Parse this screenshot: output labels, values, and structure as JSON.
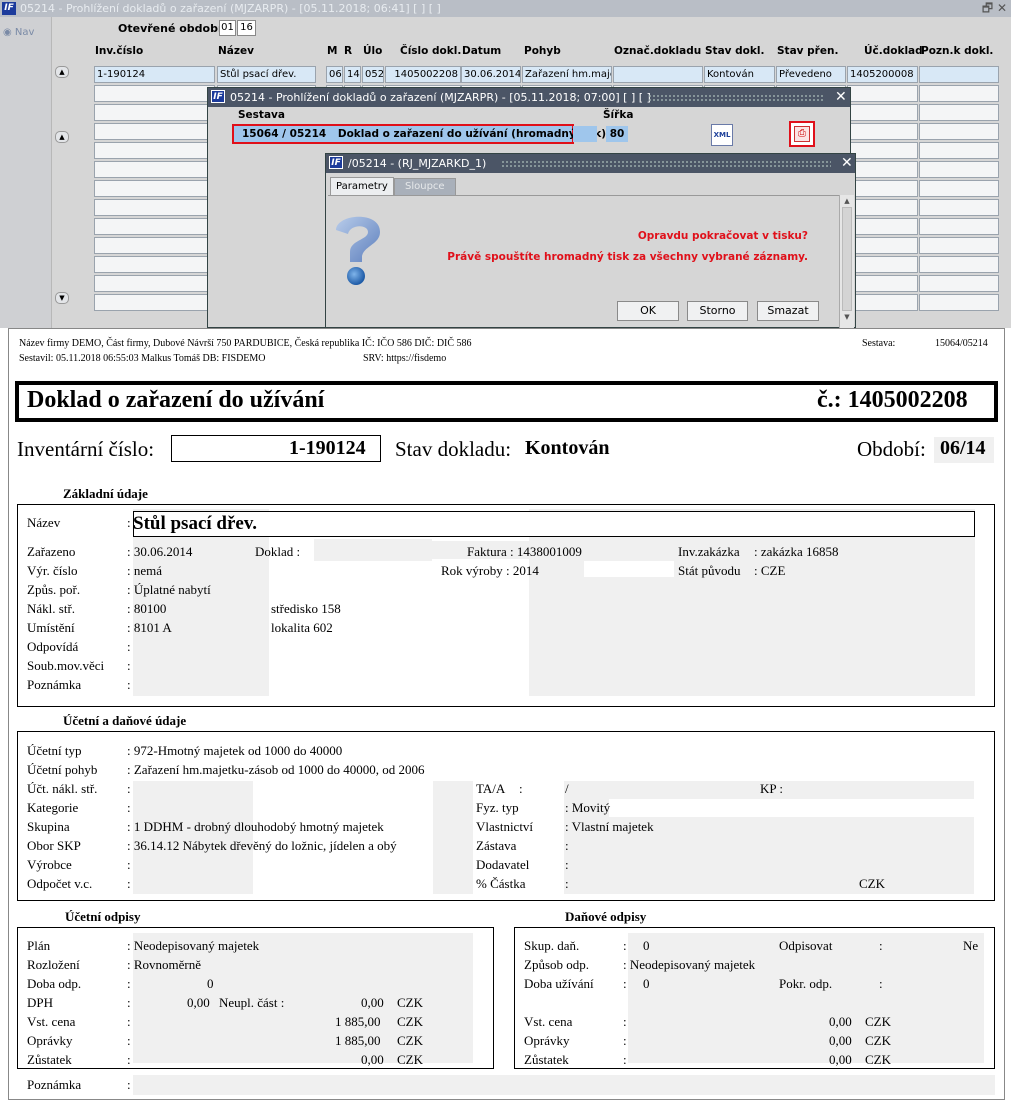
{
  "app": {
    "title": "05214 - Prohlížení dokladů o zařazení (MJZARPR) - [05.11.2018; 06:41] [ ] [ ]",
    "logo": "IF",
    "controls": "🗗 ✕",
    "nav_label": "◉ Nav",
    "period_label": "Otevřené období",
    "period_month": "01",
    "period_year": "16",
    "columns": [
      "Inv.číslo",
      "Název",
      "M",
      "R",
      "Úlo",
      "Číslo dokl.",
      "Datum",
      "Pohyb",
      "Označ.dokladu",
      "Stav dokl.",
      "Stav přen.",
      "Úč.doklad",
      "Pozn.k dokl."
    ],
    "row": {
      "inv": "1-190124",
      "nazev": "Stůl psací dřev.",
      "m": "06",
      "r": "14",
      "ulo": "052",
      "cislo": "1405002208",
      "datum": "30.06.2014",
      "pohyb": "Zařazení hm.maje",
      "oznac": "",
      "stav": "Kontován",
      "stav_pren": "Převedeno",
      "uc_doklad": "1405200008"
    }
  },
  "dialog1": {
    "title": "05214 - Prohlížení dokladů o zařazení (MJZARPR) - [05.11.2018; 07:00] [ ] [ ]",
    "sestava_label": "Sestava",
    "sirka_label": "Šířka",
    "report_code": "15064 / 05214",
    "report_name": "Doklad o zařazení do užívání (hromadný tisk)",
    "sirka_value": "80",
    "xml_label": "XML"
  },
  "dialog2": {
    "title": "/05214 - (RJ_MJZARKD_1)",
    "tab_params": "Parametry",
    "tab_cols": "Sloupce",
    "msg1": "Opravdu pokračovat v tisku?",
    "msg2": "Právě spouštíte hromadný tisk za všechny vybrané záznamy.",
    "ok": "OK",
    "storno": "Storno",
    "smazat": "Smazat"
  },
  "sheet": {
    "header_line1": "Název firmy DEMO, Část firmy, Dubové Návrší 750 PARDUBICE, Česká republika  IČ: IČO 586  DIČ: DIČ 586",
    "header_line2": "Sestavil: 05.11.2018 06:55:03 Malkus Tomáš  DB: FISDEMO",
    "srv": "SRV: https://fisdemo",
    "sestava_label": "Sestava:",
    "sestava_value": "15064/05214",
    "doc_title": "Doklad o zařazení do užívání",
    "doc_number": "č.: 1405002208",
    "inv_label": "Inventární číslo:",
    "inv_value": "1-190124",
    "stav_label": "Stav dokladu:",
    "stav_value": "Kontován",
    "obdobi_label": "Období:",
    "obdobi_value": "06/14",
    "sec_zakladni": "Základní údaje",
    "nazev_label": "Název",
    "nazev_value": "Stůl psací dřev.",
    "zarazeno_label": "Zařazeno",
    "zarazeno_value": ": 30.06.2014",
    "doklad_label": "Doklad :",
    "faktura_label": "Faktura : 1438001009",
    "invzakazka_label": "Inv.zakázka",
    "invzakazka_value": ": zakázka 16858",
    "vyrcislo_label": "Výr. číslo",
    "vyrcislo_value": ": nemá",
    "rokvyroby_label": "Rok výroby : 2014",
    "statpuvodu_label": "Stát původu",
    "statpuvodu_value": ": CZE",
    "zpuspor_label": "Způs. poř.",
    "zpuspor_value": ": Úplatné nabytí",
    "naklstr_label": "Nákl. stř.",
    "naklstr_value": ": 80100",
    "naklstr_name": "středisko 158",
    "umisteni_label": "Umístění",
    "umisteni_value": ": 8101 A",
    "umisteni_name": "lokalita 602",
    "odpovida_label": "Odpovídá",
    "soubmov_label": "Soub.mov.věci",
    "poznamka_label": "Poznámka",
    "colon": ":",
    "sec_ucetni": "Účetní a daňové údaje",
    "uctyp_label": "Účetní typ",
    "uctyp_value": ": 972-Hmotný majetek od 1000 do 40000",
    "ucpohyb_label": "Účetní pohyb",
    "ucpohyb_value": ": Zařazení hm.majetku-zásob od 1000 do 40000, od 2006",
    "ucnakl_label": "Účt. nákl. stř.",
    "taa_label": "TA/A",
    "taa_sep": "/",
    "kp_label": "KP :",
    "kategorie_label": "Kategorie",
    "fyztyp_label": "Fyz. typ",
    "fyztyp_value": ": Movitý",
    "skupina_label": "Skupina",
    "skupina_value": ": 1 DDHM - drobný dlouhodobý hmotný majetek",
    "vlastnictvi_label": "Vlastnictví",
    "vlastnictvi_value": ": Vlastní majetek",
    "oborskp_label": "Obor SKP",
    "oborskp_value": ": 36.14.12 Nábytek dřevěný do ložnic, jídelen a obý",
    "zastava_label": "Zástava",
    "vyrobce_label": "Výrobce",
    "dodavatel_label": "Dodavatel",
    "odpocet_label": "Odpočet v.c.",
    "castka_label": "%  Částka",
    "czk": "CZK",
    "sec_ucodpisy": "Účetní odpisy",
    "sec_danodpisy": "Daňové odpisy",
    "plan_label": "Plán",
    "plan_value": ": Neodepisovaný majetek",
    "rozlozeni_label": "Rozložení",
    "rozlozeni_value": ": Rovnoměrně",
    "dobaodp_label": "Doba odp.",
    "dobaodp_value": "0",
    "dph_label": "DPH",
    "dph_value": "0,00",
    "neupl_label": "Neupl. část  :",
    "neupl_value": "0,00",
    "vstcena_label": "Vst. cena",
    "vstcena_value": "1 885,00",
    "opravky_label": "Oprávky",
    "opravky_value": "1 885,00",
    "zustatek_label": "Zůstatek",
    "zustatek_value": "0,00",
    "skupdan_label": "Skup. daň.",
    "skupdan_value": "0",
    "odpisovat_label": "Odpisovat",
    "odpisovat_value": "Ne",
    "zpusobodp_label": "Způsob odp.",
    "zpusobodp_value": ": Neodepisovaný majetek",
    "dobauziv_label": "Doba užívání",
    "dobauziv_value": "0",
    "pokrodp_label": "Pokr. odp.",
    "dan_vstcena_value": "0,00",
    "dan_opravky_value": "0,00",
    "dan_zustatek_value": "0,00",
    "poznamka2_label": "Poznámka"
  }
}
